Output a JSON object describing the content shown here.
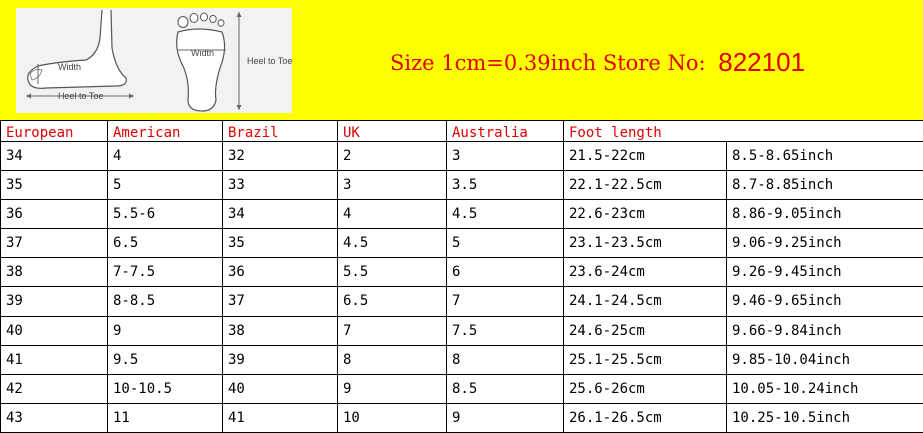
{
  "banner": {
    "size_text": "Size 1cm=0.39inch Store No:",
    "store_no": "822101",
    "illustration": {
      "side_width_label": "Width",
      "side_heel_label": "Heel to Toe",
      "sole_width_label": "Width",
      "sole_heel_label": "Heel to Toe"
    },
    "colors": {
      "background": "#ffff00",
      "text": "#e00000"
    }
  },
  "table": {
    "headers": [
      "European",
      "American",
      "Brazil",
      "UK",
      "Australia",
      "Foot length"
    ],
    "rows": [
      [
        "34",
        "4",
        "32",
        "2",
        "3",
        "21.5-22cm",
        "8.5-8.65inch"
      ],
      [
        "35",
        "5",
        "33",
        "3",
        "3.5",
        "22.1-22.5cm",
        "8.7-8.85inch"
      ],
      [
        "36",
        "5.5-6",
        "34",
        "4",
        "4.5",
        "22.6-23cm",
        "8.86-9.05inch"
      ],
      [
        "37",
        "6.5",
        "35",
        "4.5",
        "5",
        "23.1-23.5cm",
        "9.06-9.25inch"
      ],
      [
        "38",
        "7-7.5",
        "36",
        "5.5",
        "6",
        "23.6-24cm",
        "9.26-9.45inch"
      ],
      [
        "39",
        "8-8.5",
        "37",
        "6.5",
        "7",
        "24.1-24.5cm",
        "9.46-9.65inch"
      ],
      [
        "40",
        "9",
        "38",
        "7",
        "7.5",
        "24.6-25cm",
        "9.66-9.84inch"
      ],
      [
        "41",
        "9.5",
        "39",
        "8",
        "8",
        "25.1-25.5cm",
        "9.85-10.04inch"
      ],
      [
        "42",
        "10-10.5",
        "40",
        "9",
        "8.5",
        "25.6-26cm",
        "10.05-10.24inch"
      ],
      [
        "43",
        "11",
        "41",
        "10",
        "9",
        "26.1-26.5cm",
        "10.25-10.5inch"
      ]
    ]
  }
}
